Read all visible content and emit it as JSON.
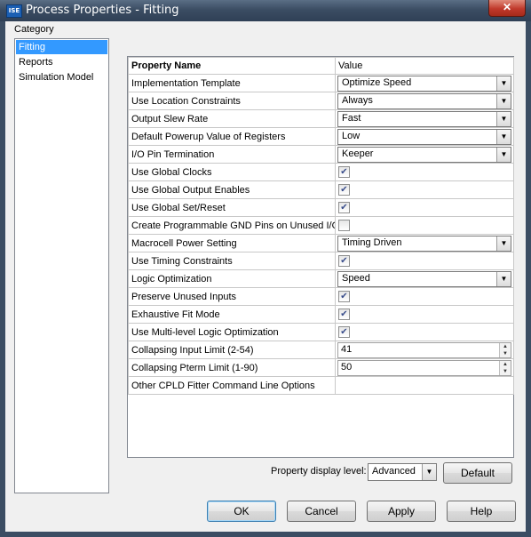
{
  "window": {
    "title": "Process Properties - Fitting",
    "app_icon_text": "ISE",
    "close_glyph": "✕"
  },
  "category": {
    "label": "Category",
    "items": [
      {
        "label": "Fitting",
        "selected": true
      },
      {
        "label": "Reports",
        "selected": false
      },
      {
        "label": "Simulation Model",
        "selected": false
      }
    ]
  },
  "properties": {
    "header_name": "Property Name",
    "header_value": "Value",
    "rows": [
      {
        "name": "Implementation Template",
        "type": "combo",
        "value": "Optimize Speed"
      },
      {
        "name": "Use Location Constraints",
        "type": "combo",
        "value": "Always"
      },
      {
        "name": "Output Slew Rate",
        "type": "combo",
        "value": "Fast"
      },
      {
        "name": "Default Powerup Value of Registers",
        "type": "combo",
        "value": "Low"
      },
      {
        "name": "I/O Pin Termination",
        "type": "combo",
        "value": "Keeper"
      },
      {
        "name": "Use Global Clocks",
        "type": "check",
        "checked": true
      },
      {
        "name": "Use Global Output Enables",
        "type": "check",
        "checked": true
      },
      {
        "name": "Use Global Set/Reset",
        "type": "check",
        "checked": true
      },
      {
        "name": "Create Programmable GND Pins on Unused I/O",
        "type": "check",
        "checked": false
      },
      {
        "name": "Macrocell Power Setting",
        "type": "combo",
        "value": "Timing Driven"
      },
      {
        "name": "Use Timing Constraints",
        "type": "check",
        "checked": true
      },
      {
        "name": "Logic Optimization",
        "type": "combo",
        "value": "Speed"
      },
      {
        "name": "Preserve Unused Inputs",
        "type": "check",
        "checked": true
      },
      {
        "name": "Exhaustive Fit Mode",
        "type": "check",
        "checked": true
      },
      {
        "name": "Use Multi-level Logic Optimization",
        "type": "check",
        "checked": true
      },
      {
        "name": "Collapsing Input Limit (2-54)",
        "type": "spin",
        "value": "41"
      },
      {
        "name": "Collapsing Pterm Limit (1-90)",
        "type": "spin",
        "value": "50"
      },
      {
        "name": "Other CPLD Fitter Command Line Options",
        "type": "text",
        "value": ""
      }
    ]
  },
  "display_level": {
    "label": "Property display level:",
    "value": "Advanced"
  },
  "buttons": {
    "default": "Default",
    "ok": "OK",
    "cancel": "Cancel",
    "apply": "Apply",
    "help": "Help"
  },
  "glyphs": {
    "dropdown": "▼",
    "check": "✔",
    "spin_up": "▲",
    "spin_down": "▼"
  }
}
